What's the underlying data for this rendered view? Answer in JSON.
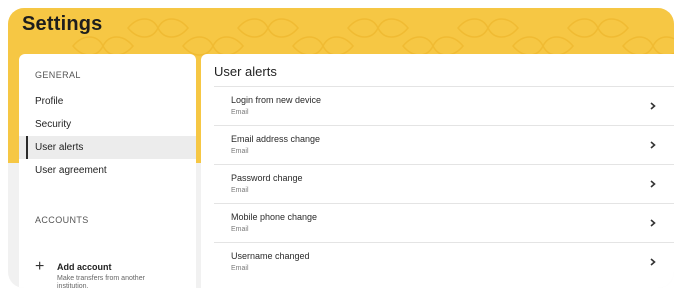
{
  "page": {
    "title": "Settings"
  },
  "colors": {
    "banner": "#f6c744",
    "background": "#f1f1f1",
    "panel": "#ffffff",
    "active_indicator": "#2a2a2a"
  },
  "sidebar": {
    "general_heading": "GENERAL",
    "items": [
      {
        "label": "Profile"
      },
      {
        "label": "Security"
      },
      {
        "label": "User alerts",
        "active": true
      },
      {
        "label": "User agreement"
      }
    ],
    "accounts_heading": "ACCOUNTS",
    "add_account": {
      "icon": "plus-icon",
      "label": "Add account",
      "description": "Make transfers from another institution."
    }
  },
  "main": {
    "title": "User alerts",
    "alerts": [
      {
        "name": "Login from new device",
        "channel": "Email",
        "icon": "chevron-right-icon"
      },
      {
        "name": "Email address change",
        "channel": "Email",
        "icon": "chevron-right-icon"
      },
      {
        "name": "Password change",
        "channel": "Email",
        "icon": "chevron-right-icon"
      },
      {
        "name": "Mobile phone change",
        "channel": "Email",
        "icon": "chevron-right-icon"
      },
      {
        "name": "Username changed",
        "channel": "Email",
        "icon": "chevron-right-icon"
      }
    ]
  }
}
